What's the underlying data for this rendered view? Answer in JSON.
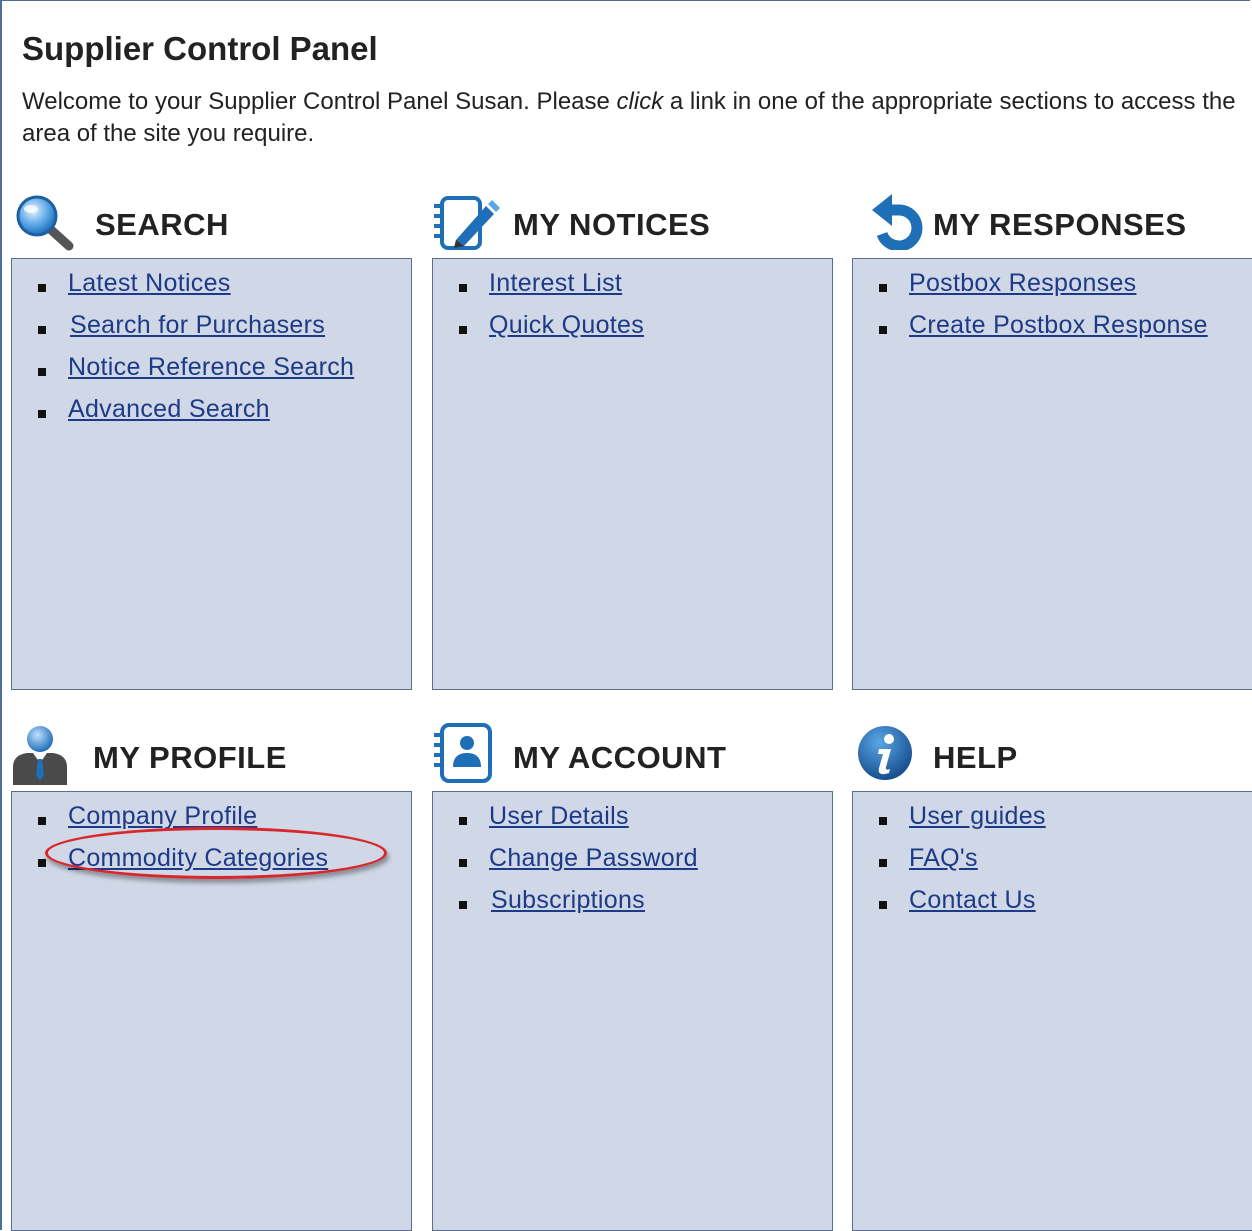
{
  "page": {
    "title": "Supplier Control Panel",
    "intro_before": "Welcome to your Supplier Control Panel Susan. Please ",
    "intro_em": "click",
    "intro_after": " a link in one of the appropriate sections to access the area of the site you require."
  },
  "sections": [
    {
      "title": "SEARCH",
      "icon": "search-icon",
      "links": [
        "Latest Notices",
        "Search for Purchasers",
        "Notice Reference Search",
        "Advanced Search"
      ]
    },
    {
      "title": "MY NOTICES",
      "icon": "notepad-edit-icon",
      "links": [
        "Interest List",
        "Quick Quotes"
      ]
    },
    {
      "title": "MY RESPONSES",
      "icon": "reply-arrow-icon",
      "links": [
        "Postbox Responses",
        "Create Postbox Response"
      ]
    },
    {
      "title": "MY PROFILE",
      "icon": "user-profile-icon",
      "links": [
        "Company Profile",
        "Commodity Categories"
      ]
    },
    {
      "title": "MY ACCOUNT",
      "icon": "contact-card-icon",
      "links": [
        "User Details",
        "Change Password",
        "Subscriptions"
      ]
    },
    {
      "title": "HELP",
      "icon": "info-icon",
      "links": [
        "User guides",
        "FAQ's",
        "Contact Us"
      ]
    }
  ],
  "colors": {
    "box_bg": "#d0d7e6",
    "link": "#1d3a87",
    "highlight_circle": "#d9262b",
    "icon_blue": "#1f6fb8"
  }
}
